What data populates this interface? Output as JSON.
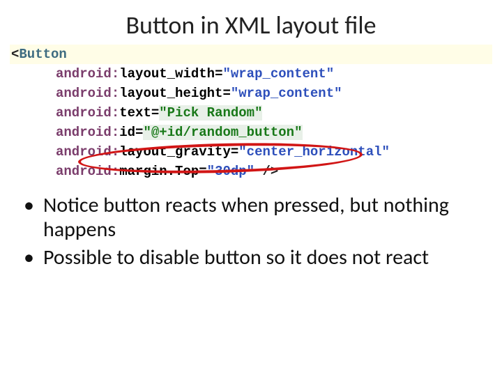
{
  "title": "Button in XML layout file",
  "code": {
    "open_sym": "<",
    "tag": "Button",
    "ns": "android",
    "sep": ":",
    "eq": "=",
    "close_sym": " />",
    "attrs": [
      {
        "name": "layout_width",
        "value": "\"wrap_content\"",
        "highlight": false
      },
      {
        "name": "layout_height",
        "value": "\"wrap_content\"",
        "highlight": false
      },
      {
        "name": "text",
        "value": "\"Pick Random\"",
        "highlight": true
      },
      {
        "name": "id",
        "value": "\"@+id/random_button\"",
        "highlight": true
      },
      {
        "name": "layout_gravity",
        "value": "\"center_horizontal\"",
        "highlight": false
      },
      {
        "name": "margin.Top",
        "value": "\"30dp\"",
        "highlight": false
      }
    ]
  },
  "bullets": [
    "Notice button reacts when pressed, but nothing happens",
    "Possible to disable button so it does not react"
  ]
}
